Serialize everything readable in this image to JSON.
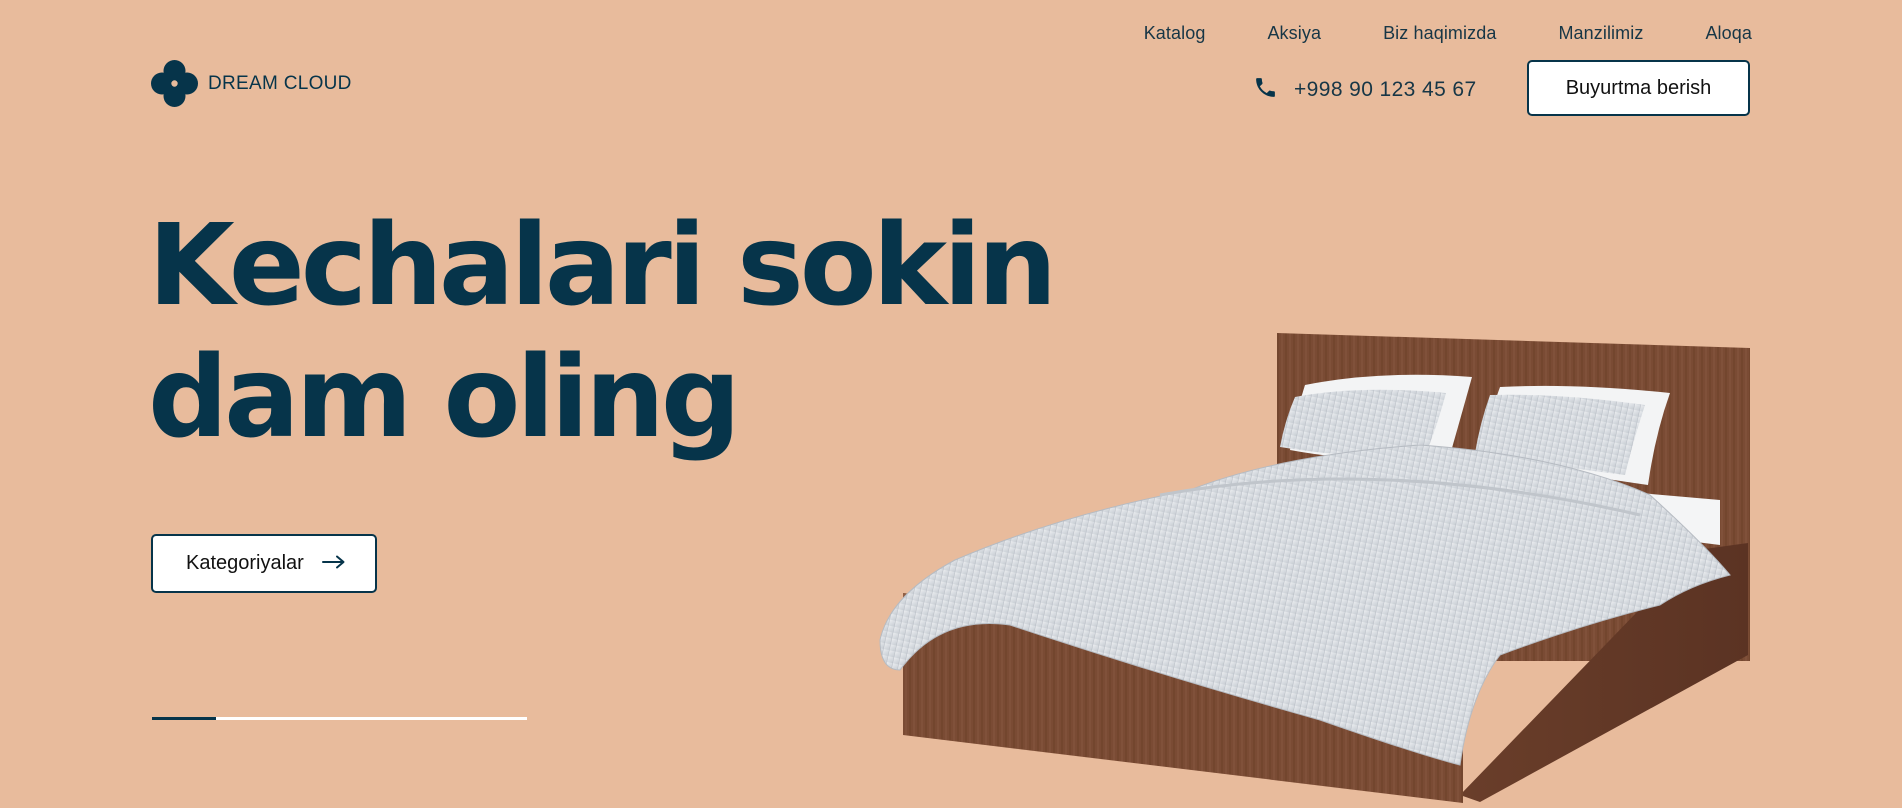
{
  "brand": {
    "name": "DREAM CLOUD"
  },
  "nav": {
    "items": [
      {
        "label": "Katalog"
      },
      {
        "label": "Aksiya"
      },
      {
        "label": "Biz haqimizda"
      },
      {
        "label": "Manzilimiz"
      },
      {
        "label": "Aloqa"
      }
    ]
  },
  "contact": {
    "phone": "+998 90 123 45 67",
    "phone_icon": "phone-icon"
  },
  "header": {
    "order_button_label": "Buyurtma berish"
  },
  "hero": {
    "title_line1": "Kechalari sokin",
    "title_line2": "dam oling",
    "categories_button_label": "Kategoriyalar",
    "categories_button_icon": "arrow-right-icon",
    "slider_progress_fraction": 0.17
  },
  "colors": {
    "background": "#E8BB9C",
    "primary": "#06344A",
    "button_bg": "#FFFFFF"
  }
}
